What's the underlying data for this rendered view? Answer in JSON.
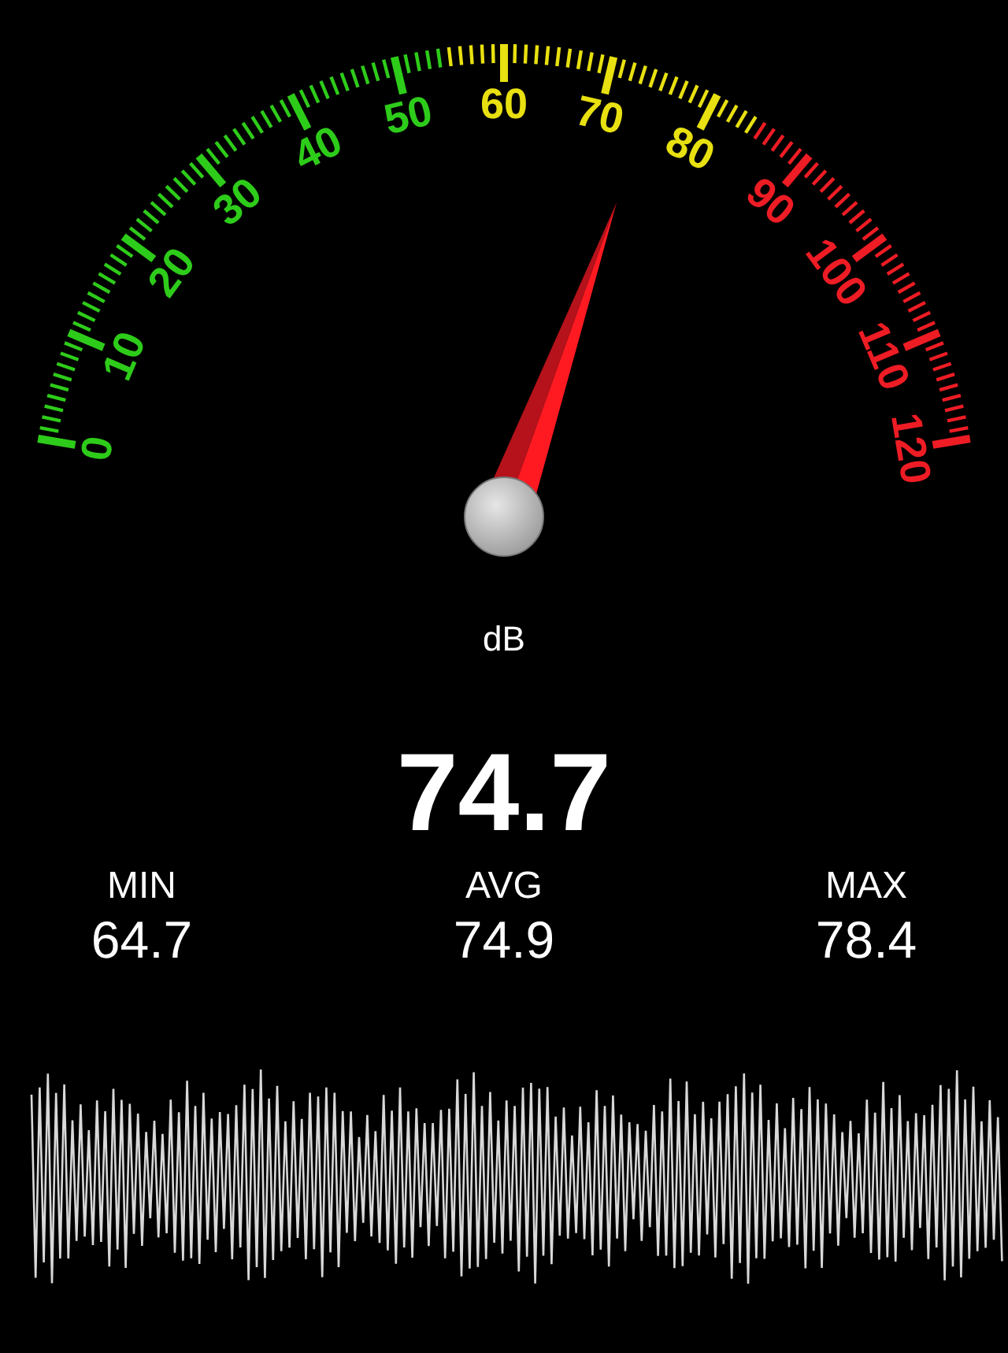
{
  "gauge": {
    "scale_labels": [
      {
        "text": "0",
        "color": "#2ecc1a"
      },
      {
        "text": "10",
        "color": "#2ecc1a"
      },
      {
        "text": "20",
        "color": "#2ecc1a"
      },
      {
        "text": "30",
        "color": "#2ecc1a"
      },
      {
        "text": "40",
        "color": "#2ecc1a"
      },
      {
        "text": "50",
        "color": "#2ecc1a"
      },
      {
        "text": "60",
        "color": "#e8e010"
      },
      {
        "text": "70",
        "color": "#e8e010"
      },
      {
        "text": "80",
        "color": "#e8e010"
      },
      {
        "text": "90",
        "color": "#ee1c24"
      },
      {
        "text": "100",
        "color": "#ee1c24"
      },
      {
        "text": "110",
        "color": "#ee1c24"
      },
      {
        "text": "120",
        "color": "#ee1c24"
      }
    ]
  },
  "unit": "dB",
  "reading": "74.7",
  "stats": [
    {
      "label": "MIN",
      "value": "64.7"
    },
    {
      "label": "AVG",
      "value": "74.9"
    },
    {
      "label": "MAX",
      "value": "78.4"
    }
  ]
}
